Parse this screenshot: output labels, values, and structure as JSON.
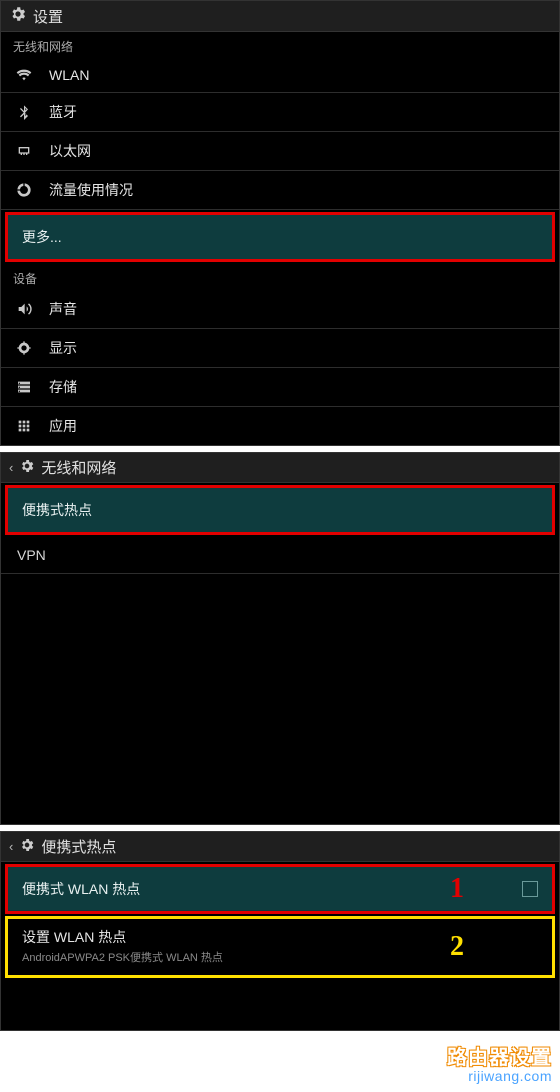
{
  "panel1": {
    "title": "设置",
    "section_wireless": "无线和网络",
    "items_wireless": [
      {
        "icon": "wifi",
        "label": "WLAN"
      },
      {
        "icon": "bluetooth",
        "label": "蓝牙"
      },
      {
        "icon": "ethernet",
        "label": "以太网"
      },
      {
        "icon": "data-usage",
        "label": "流量使用情况"
      }
    ],
    "more_label": "更多...",
    "section_device": "设备",
    "items_device": [
      {
        "icon": "sound",
        "label": "声音"
      },
      {
        "icon": "display",
        "label": "显示"
      },
      {
        "icon": "storage",
        "label": "存储"
      },
      {
        "icon": "apps",
        "label": "应用"
      }
    ]
  },
  "panel2": {
    "title": "无线和网络",
    "hotspot_label": "便携式热点",
    "vpn_label": "VPN"
  },
  "panel3": {
    "title": "便携式热点",
    "row1_label": "便携式 WLAN 热点",
    "row1_checked": false,
    "row2_title": "设置 WLAN 热点",
    "row2_sub": "AndroidAPWPA2 PSK便携式 WLAN 热点",
    "annot1": "1",
    "annot2": "2"
  },
  "watermark": {
    "line1": "路由器设置",
    "line2": "rijiwang.com"
  }
}
